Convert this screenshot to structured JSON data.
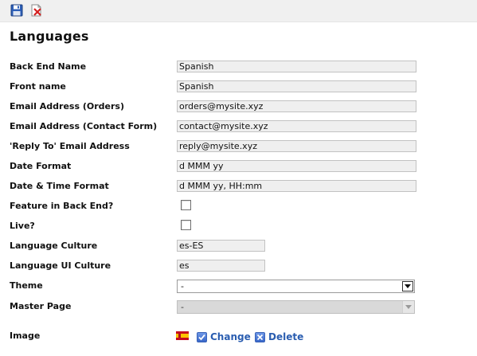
{
  "toolbar": {
    "save_icon": "floppy-disk-icon",
    "delete_icon": "delete-document-icon"
  },
  "page": {
    "title": "Languages"
  },
  "form": {
    "back_end_name": {
      "label": "Back End Name",
      "value": "Spanish"
    },
    "front_name": {
      "label": "Front name",
      "value": "Spanish"
    },
    "email_orders": {
      "label": "Email Address (Orders)",
      "value": "orders@mysite.xyz"
    },
    "email_contact": {
      "label": "Email Address (Contact Form)",
      "value": "contact@mysite.xyz"
    },
    "reply_to": {
      "label": "'Reply To' Email Address",
      "value": "reply@mysite.xyz"
    },
    "date_format": {
      "label": "Date Format",
      "value": "d MMM yy"
    },
    "date_time_format": {
      "label": "Date & Time Format",
      "value": "d MMM yy, HH:mm"
    },
    "feature_back_end": {
      "label": "Feature in Back End?",
      "checked": false
    },
    "live": {
      "label": "Live?",
      "checked": false
    },
    "language_culture": {
      "label": "Language Culture",
      "value": "es-ES"
    },
    "language_ui_culture": {
      "label": "Language UI Culture",
      "value": "es"
    },
    "theme": {
      "label": "Theme",
      "selected": "-",
      "enabled": true
    },
    "master_page": {
      "label": "Master Page",
      "selected": "-",
      "enabled": false
    },
    "image": {
      "label": "Image",
      "flag_icon": "spain-flag-icon",
      "change_label": "Change",
      "delete_label": "Delete"
    }
  },
  "colors": {
    "toolbar_bg": "#f0f0f0",
    "field_bg": "#efefef",
    "link": "#2a5db0",
    "disabled_select_bg": "#d9d9d9"
  }
}
